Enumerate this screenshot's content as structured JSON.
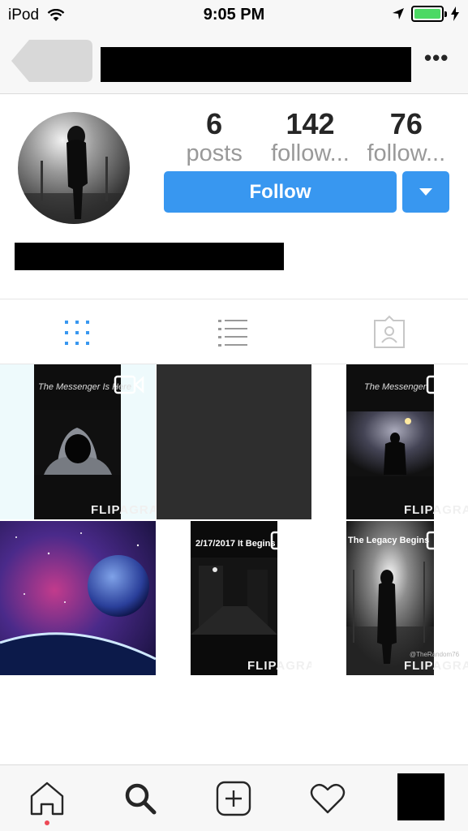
{
  "status_bar": {
    "carrier": "iPod",
    "time": "9:05 PM",
    "battery_color": "#4cd964"
  },
  "nav": {
    "back_icon": "back-arrow-icon",
    "more_icon": "more-dots-icon",
    "more_label": "•••"
  },
  "profile": {
    "stats": [
      {
        "value": "6",
        "label": "posts"
      },
      {
        "value": "142",
        "label": "follow..."
      },
      {
        "value": "76",
        "label": "follow..."
      }
    ],
    "follow_label": "Follow",
    "accent_color": "#3897f0"
  },
  "view_tabs": [
    "grid-icon",
    "list-icon",
    "tagged-photos-icon"
  ],
  "posts": [
    {
      "caption": "The Messenger Is Here",
      "watermark": "FLIPAGRAM",
      "video": true
    },
    {
      "caption": "",
      "watermark": "",
      "video": false
    },
    {
      "caption": "The Messenger",
      "watermark": "FLIPAGRAM",
      "video": true
    },
    {
      "caption": "",
      "watermark": "",
      "video": false
    },
    {
      "caption": "2/17/2017 It Begins",
      "watermark": "FLIPAGRAM",
      "video": true
    },
    {
      "caption": "The Legacy Begins",
      "watermark": "FLIPAGRAM",
      "handle": "@TheRandom76",
      "video": true
    }
  ],
  "tab_bar": [
    "home-icon",
    "search-icon",
    "add-post-icon",
    "activity-heart-icon",
    "profile-tab"
  ]
}
